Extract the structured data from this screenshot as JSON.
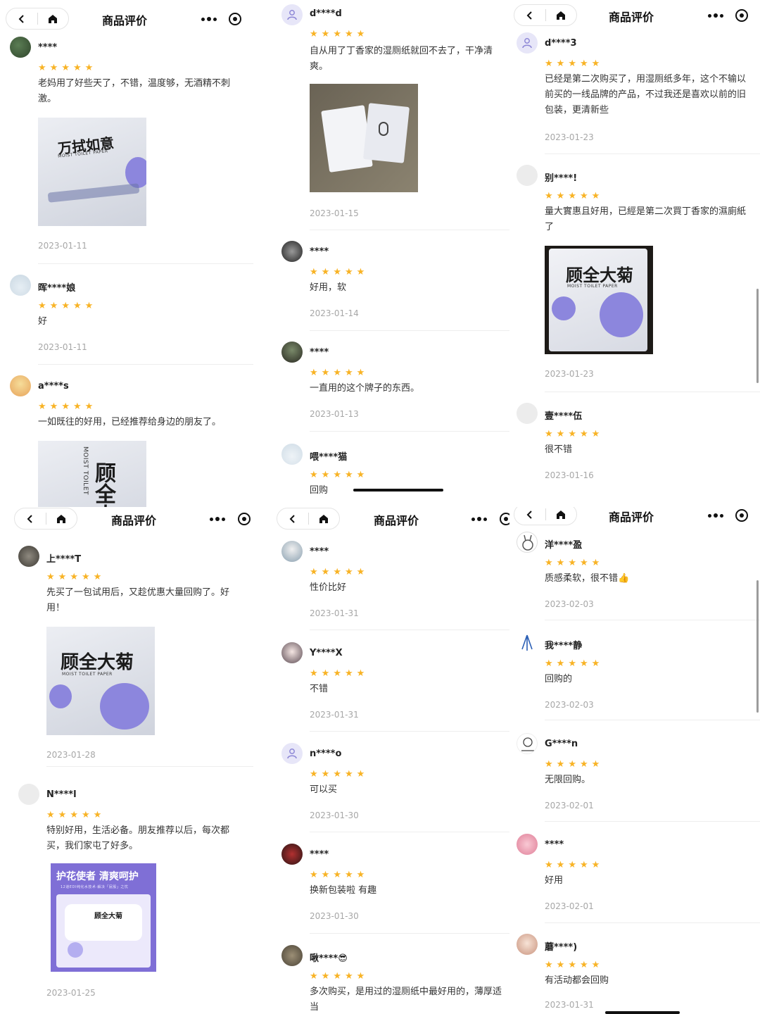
{
  "nav": {
    "title": "商品评价"
  },
  "colors": {
    "star": "#f8b325",
    "date": "#a7a7a7",
    "divider": "#eeeeee"
  },
  "panels": [
    {
      "reviews": [
        {
          "user": "****",
          "text": "老妈用了好些天了，不错，温度够，无酒精不刺激。",
          "photo": {
            "title": "万拭如意",
            "subtitle": "MOIST TOILET PAPER"
          },
          "date": "2023-01-11"
        },
        {
          "user": "晖****娘",
          "text": "好",
          "date": "2023-01-11"
        },
        {
          "user": "a****s",
          "text": "一如既往的好用，已经推荐给身边的朋友了。",
          "photo": {
            "title": "顾全大",
            "subtitle": "MOIST TOILET"
          }
        }
      ]
    },
    {
      "reviews": [
        {
          "user": "d****d",
          "text": "自从用了丁香家的湿厕纸就回不去了，干净清爽。",
          "date": "2023-01-15"
        },
        {
          "user": "****",
          "text": "好用，软",
          "date": "2023-01-14"
        },
        {
          "user": "****",
          "text": "一直用的这个牌子的东西。",
          "date": "2023-01-13"
        },
        {
          "user": "喂****猫",
          "text": "回购"
        }
      ]
    },
    {
      "reviews": [
        {
          "user": "d****3",
          "text": "已经是第二次购买了，用湿厕纸多年，这个不输以前买的一线品牌的产品，不过我还是喜欢以前的旧包装，更清新些",
          "date": "2023-01-23"
        },
        {
          "user": "别****!",
          "text": "量大實惠且好用，已經是第二次買丁香家的濕廁紙了",
          "photo": {
            "title": "顾全大菊",
            "subtitle": "MOIST TOILET PAPER"
          },
          "date": "2023-01-23"
        },
        {
          "user": "壹****伍",
          "text": "很不错",
          "date": "2023-01-16"
        }
      ]
    },
    {
      "reviews": [
        {
          "user": "上****T",
          "text": "先买了一包试用后，又趁优惠大量回购了。好用！",
          "photo": {
            "title": "顾全大菊",
            "subtitle": "MOIST TOILET PAPER"
          },
          "date": "2023-01-28"
        },
        {
          "user": "N****l",
          "text": "特别好用，生活必备。朋友推荐以后，每次都买，我们家屯了好多。",
          "photo": {
            "title": "护花使者 清爽呵护",
            "subtitle": "12道EDI纯化水技术·解决「屁股」之忧",
            "badge": "顾全大菊"
          },
          "date": "2023-01-25"
        }
      ]
    },
    {
      "reviews": [
        {
          "user": "****",
          "text": "性价比好",
          "date": "2023-01-31"
        },
        {
          "user": "Y****X",
          "text": "不错",
          "date": "2023-01-31"
        },
        {
          "user": "n****o",
          "text": "可以买",
          "date": "2023-01-30"
        },
        {
          "user": "****",
          "text": "换新包装啦 有趣",
          "date": "2023-01-30"
        },
        {
          "user": "啾****😎",
          "text": "多次购买，是用过的湿厕纸中最好用的，薄厚适当"
        }
      ]
    },
    {
      "reviews": [
        {
          "user": "洋****盈",
          "text": "质感柔软，很不错👍",
          "date": "2023-02-03"
        },
        {
          "user": "我****静",
          "text": "回购的",
          "date": "2023-02-03"
        },
        {
          "user": "G****n",
          "text": "无限回购。",
          "date": "2023-02-01"
        },
        {
          "user": "****",
          "text": "好用",
          "date": "2023-02-01"
        },
        {
          "user": "蘑****)",
          "text": "有活动都会回购",
          "date": "2023-01-31"
        }
      ]
    }
  ]
}
